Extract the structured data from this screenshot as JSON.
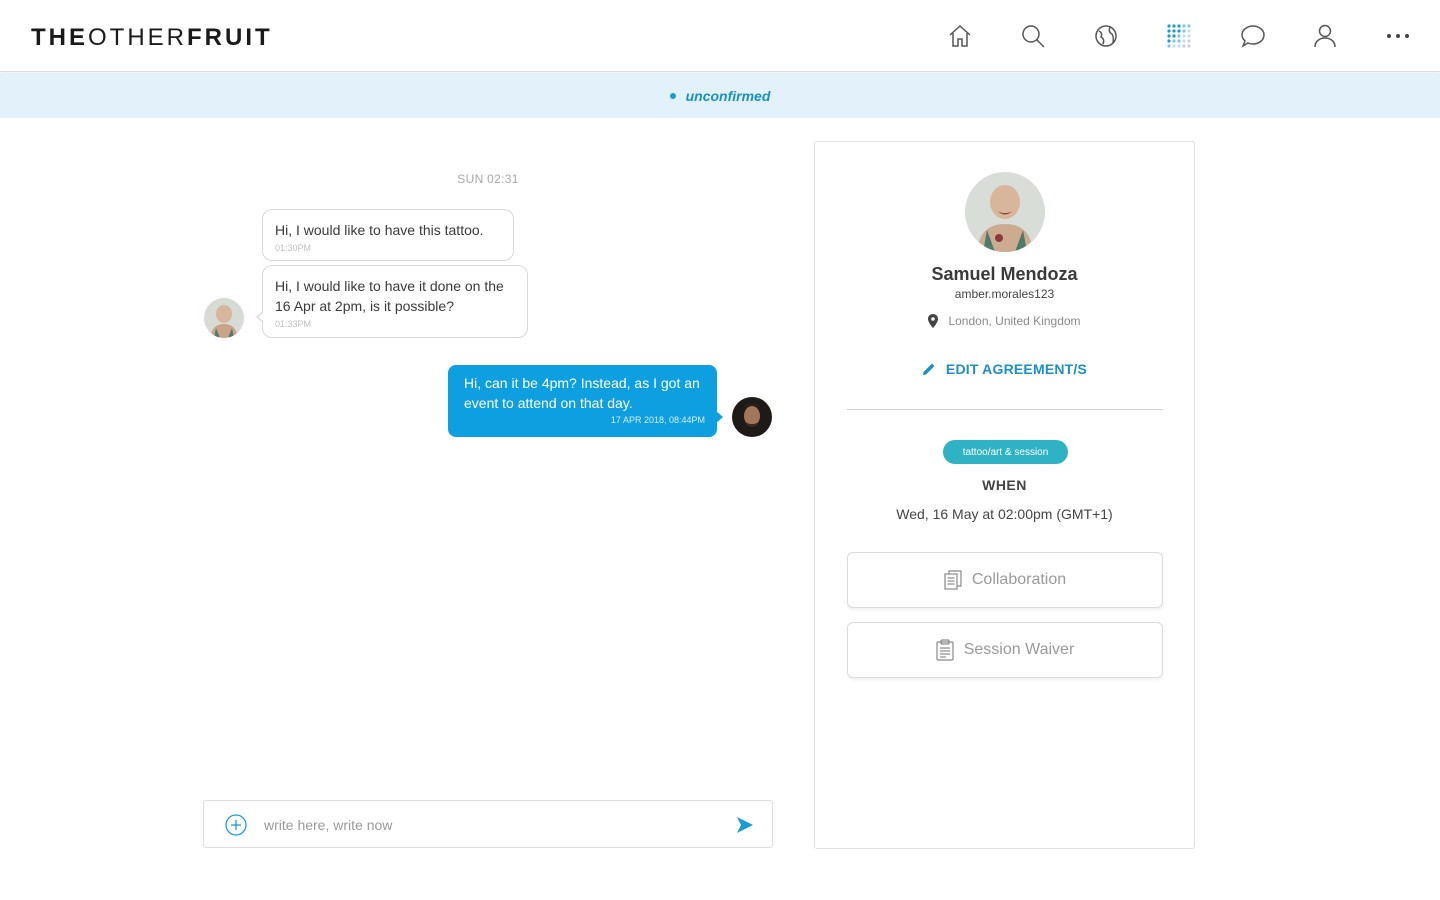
{
  "header": {
    "logo_bold_1": "THE",
    "logo_light": "OTHER",
    "logo_bold_2": "FRUIT",
    "nav": [
      {
        "icon": "home-icon"
      },
      {
        "icon": "search-icon"
      },
      {
        "icon": "globe-icon"
      },
      {
        "icon": "grid-dots-icon",
        "active": true
      },
      {
        "icon": "chat-icon"
      },
      {
        "icon": "user-icon"
      },
      {
        "icon": "more-icon"
      }
    ]
  },
  "status": {
    "text": "unconfirmed",
    "color": "#1a8fc8"
  },
  "chat": {
    "day_stamp": "SUN 02:31",
    "messages": [
      {
        "direction": "in",
        "text": "Hi, I would like to have this tattoo.",
        "time": "01:30PM"
      },
      {
        "direction": "in",
        "text": "Hi, I would like to have it done on the 16 Apr at 2pm, is it possible?",
        "time": "01:33PM"
      },
      {
        "direction": "out",
        "text": "Hi, can it be 4pm? Instead, as I got an event to attend on that day.",
        "time": "17 APR 2018, 08:44PM"
      }
    ],
    "composer_placeholder": "write here, write now"
  },
  "profile": {
    "name": "Samuel Mendoza",
    "username": "amber.morales123",
    "location": "London, United Kingdom",
    "edit_label": "EDIT AGREEMENT/S",
    "tag": "tattoo/art & session",
    "when_label": "WHEN",
    "when_value": "Wed, 16 May at 02:00pm (GMT+1)",
    "documents": [
      {
        "label": "Collaboration",
        "icon": "document-icon"
      },
      {
        "label": "Session Waiver",
        "icon": "clipboard-icon"
      }
    ]
  },
  "colors": {
    "accent": "#0d9fdf",
    "status_bg": "#e3f2fa",
    "tag": "#2fb2c4"
  }
}
